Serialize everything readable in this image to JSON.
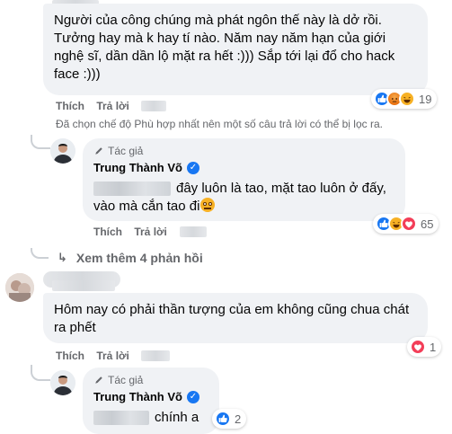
{
  "comment1": {
    "text": "Người của công chúng mà phát ngôn thế này là dở rồi. Tưởng hay mà k hay tí nào. Năm nay năm hạn của giới nghệ sĩ, dần dần lộ mặt ra hết :))) Sắp tới lại đổ cho hack face :)))",
    "like_label": "Thích",
    "reply_label": "Trả lời",
    "reaction_count": "19"
  },
  "filter_notice": "Đã chọn chế độ Phù hợp nhất nên một số câu trả lời có thể bị lọc ra.",
  "reply1": {
    "author_tag": "Tác giả",
    "author_name": "Trung Thành Võ",
    "line1": "đây luôn là tao, mặt tao luôn ở đấy,",
    "line2": "vào mà cắn tao đi",
    "like_label": "Thích",
    "reply_label": "Trả lời",
    "reaction_count": "65"
  },
  "see_more": "Xem thêm 4 phản hồi",
  "comment2": {
    "text": "Hôm nay có phải thần tượng của em không cũng chua chát ra phết",
    "like_label": "Thích",
    "reply_label": "Trả lời",
    "reaction_count": "1"
  },
  "reply2": {
    "author_tag": "Tác giả",
    "author_name": "Trung Thành Võ",
    "text": "chính a",
    "reaction_count": "2"
  },
  "icons": {
    "like": "like-icon",
    "angry": "angry-icon",
    "haha": "haha-icon",
    "love": "love-icon",
    "author": "pen-icon",
    "verified": "verified-check-icon",
    "reply_arrow": "reply-arrow-icon"
  },
  "colors": {
    "like": "#1877f2",
    "angry": "#e9710f",
    "love": "#f33e58",
    "haha": "#f7b125"
  }
}
